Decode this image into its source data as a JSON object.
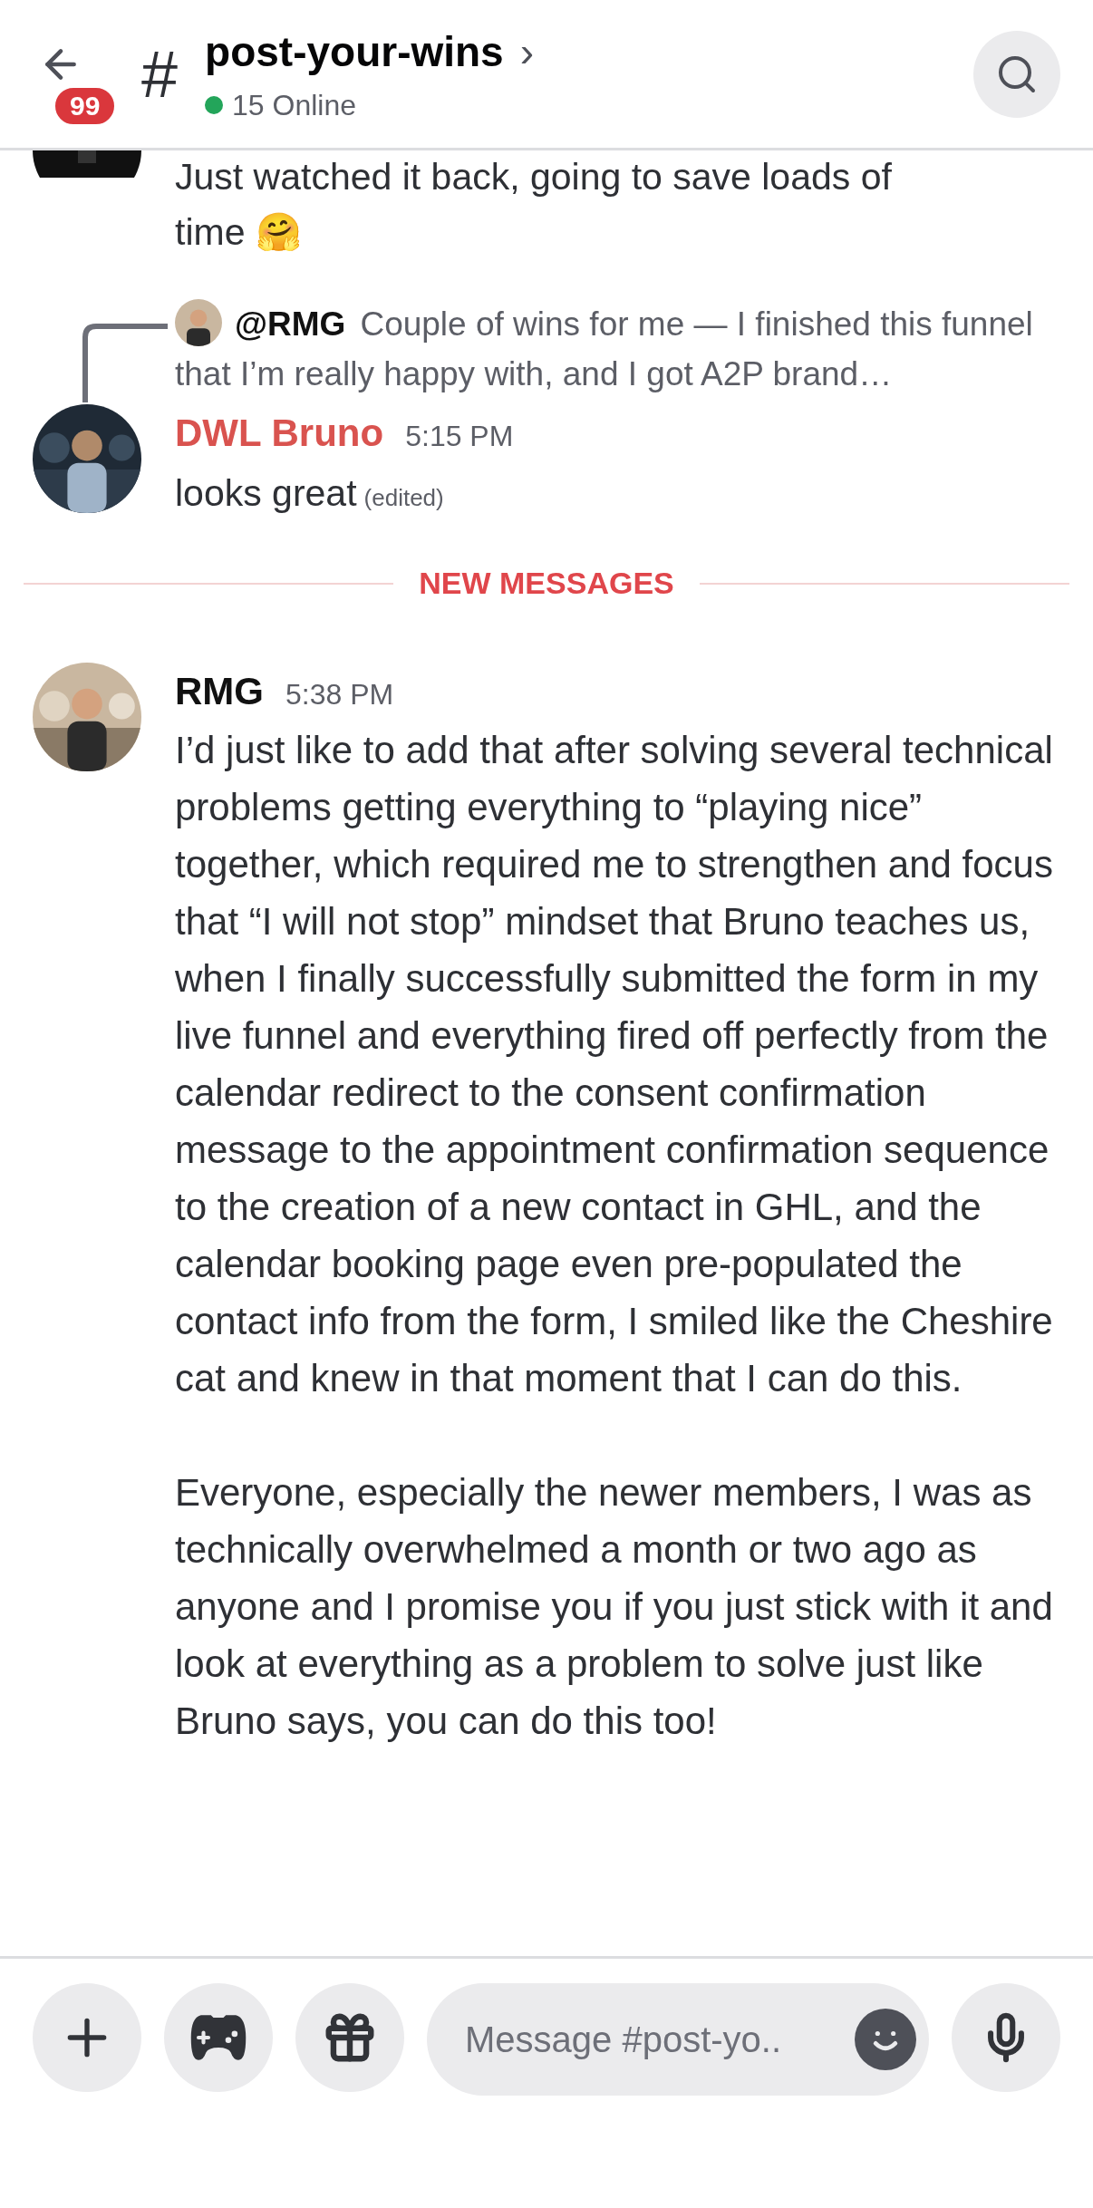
{
  "header": {
    "back_badge": "99",
    "channel_hash": "#",
    "channel": "post-your-wins",
    "chevron": "›",
    "online": "15 Online"
  },
  "messages": [
    {
      "kind": "continuation",
      "lines": [
        "Just watched it back, going to save loads of",
        "time 🤗"
      ]
    },
    {
      "kind": "reply",
      "reply_to": {
        "author": "@RMG",
        "text": "Couple of wins for me — I finished this funnel that I’m really happy with, and I got A2P brand…"
      },
      "author": "DWL Bruno",
      "color": "#d9534f",
      "time": "5:15 PM",
      "text": "looks great",
      "edited": "(edited)"
    },
    {
      "kind": "divider",
      "label": "NEW MESSAGES"
    },
    {
      "kind": "message",
      "author": "RMG",
      "color": "#111111",
      "time": "5:38 PM",
      "paragraphs": [
        "I’d just like to add that after solving several technical problems getting everything to “playing nice” together, which required me to strengthen and focus that “I will not stop” mindset that Bruno teaches us, when I finally successfully submitted the form in my live funnel and everything fired off perfectly from the calendar redirect to the consent confirmation message to the appointment confirmation sequence to the creation of a new contact in GHL, and the calendar booking page even pre-populated the contact info from the form, I smiled like the Cheshire cat and knew in that moment that I can do this.",
        "Everyone, especially the newer members, I was as technically overwhelmed a month or two ago as anyone and I promise you if you just stick with it and look at everything as a problem to solve just like Bruno says, you can do this too!"
      ]
    }
  ],
  "composer": {
    "placeholder": "Message #post-yo.."
  }
}
